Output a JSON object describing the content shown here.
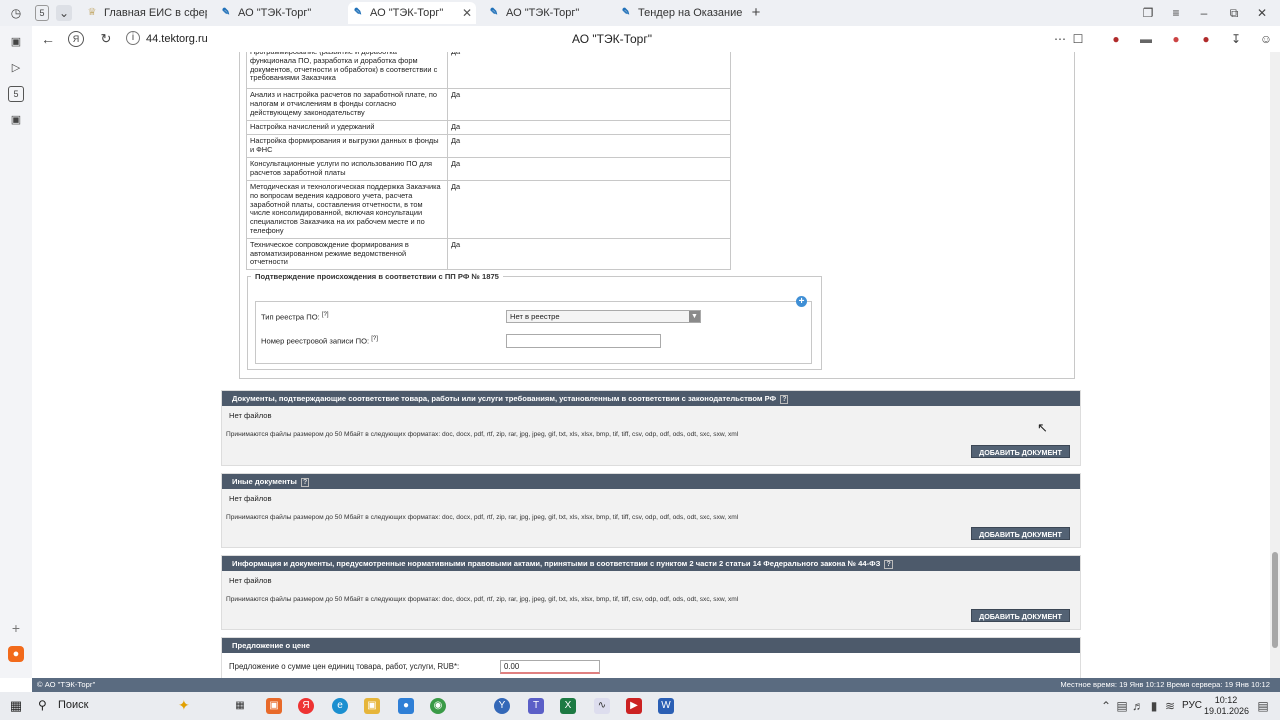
{
  "browser": {
    "tab_count": "5",
    "tabs": [
      {
        "label": "Главная ЕИС в сфере зак",
        "active": false
      },
      {
        "label": "АО \"ТЭК-Торг\"",
        "active": false
      },
      {
        "label": "АО \"ТЭК-Торг\"",
        "active": true
      },
      {
        "label": "АО \"ТЭК-Торг\"",
        "active": false
      },
      {
        "label": "Тендер на Оказание услу",
        "active": false
      }
    ],
    "url": "44.tektorg.ru",
    "page_title": "АО \"ТЭК-Торг\""
  },
  "spec_rows": [
    {
      "name": "Программирование (развитие и доработка функционала ПО, разработка и доработка форм документов, отчетности и обработок) в соответствии с требованиями Заказчика",
      "value": "Да"
    },
    {
      "name": "Анализ и настройка расчетов по заработной плате, по налогам и отчислениям в фонды согласно действующему законодательству",
      "value": "Да"
    },
    {
      "name": "Настройка начислений и удержаний",
      "value": "Да"
    },
    {
      "name": "Настройка формирования и выгрузки данных в фонды и ФНС",
      "value": "Да"
    },
    {
      "name": "Консультационные услуги по использованию ПО для расчетов заработной платы",
      "value": "Да"
    },
    {
      "name": "Методическая и технологическая поддержка Заказчика по вопросам ведения кадрового учета, расчета заработной платы, составления отчетности, в том числе консолидированной, включая консультации специалистов Заказчика на их рабочем месте и по телефону",
      "value": "Да"
    },
    {
      "name": "Техническое сопровождение формирования в автоматизированном режиме ведомственной отчетности",
      "value": "Да"
    }
  ],
  "origin": {
    "legend": "Подтверждение происхождения в соответствии с ПП РФ № 1875",
    "registry_type_label": "Тип реестра ПО:",
    "registry_type_value": "Нет в реестре",
    "registry_number_label": "Номер реестровой записи ПО:",
    "help_mark": "[?]"
  },
  "doc_sections": [
    {
      "title": "Документы, подтверждающие соответствие товара, работы или услуги требованиям, установленным в соответствии с законодательством РФ",
      "help": "?",
      "nofiles": "Нет файлов",
      "formats": "Принимаются файлы размером до 50 Мбайт в следующих форматах: doc, docx, pdf, rtf, zip, rar, jpg, jpeg, gif, txt, xls, xlsx, bmp, tif, tiff, csv, odp, odf, ods, odt, sxc, sxw, xml",
      "button": "ДОБАВИТЬ ДОКУМЕНТ"
    },
    {
      "title": "Иные документы",
      "help": "?",
      "nofiles": "Нет файлов",
      "formats": "Принимаются файлы размером до 50 Мбайт в следующих форматах: doc, docx, pdf, rtf, zip, rar, jpg, jpeg, gif, txt, xls, xlsx, bmp, tif, tiff, csv, odp, odf, ods, odt, sxc, sxw, xml",
      "button": "ДОБАВИТЬ ДОКУМЕНТ"
    },
    {
      "title": "Информация и документы, предусмотренные нормативными правовыми актами, принятыми в соответствии с пунктом 2 части 2 статьи 14 Федерального закона № 44-ФЗ",
      "help": "?",
      "nofiles": "Нет файлов",
      "formats": "Принимаются файлы размером до 50 Мбайт в следующих форматах: doc, docx, pdf, rtf, zip, rar, jpg, jpeg, gif, txt, xls, xlsx, bmp, tif, tiff, csv, odp, odf, ods, odt, sxc, sxw, xml",
      "button": "ДОБАВИТЬ ДОКУМЕНТ"
    }
  ],
  "price": {
    "title": "Предложение о цене",
    "label": "Предложение о сумме цен единиц товара, работ, услуги, RUB*:",
    "value": "0.00"
  },
  "status": {
    "copyright": "© АО \"ТЭК-Торг\"",
    "time": "Местное время: 19 Янв 10:12 Время сервера: 19 Янв 10:12"
  },
  "taskbar": {
    "search": "Поиск",
    "lang": "РУС",
    "clock_time": "10:12",
    "clock_date": "19.01.2026"
  },
  "colors": {
    "section_header": "#4d5a6b",
    "button": "#536274",
    "statusbar": "#5a6b80",
    "accent": "#3f8fd5"
  }
}
